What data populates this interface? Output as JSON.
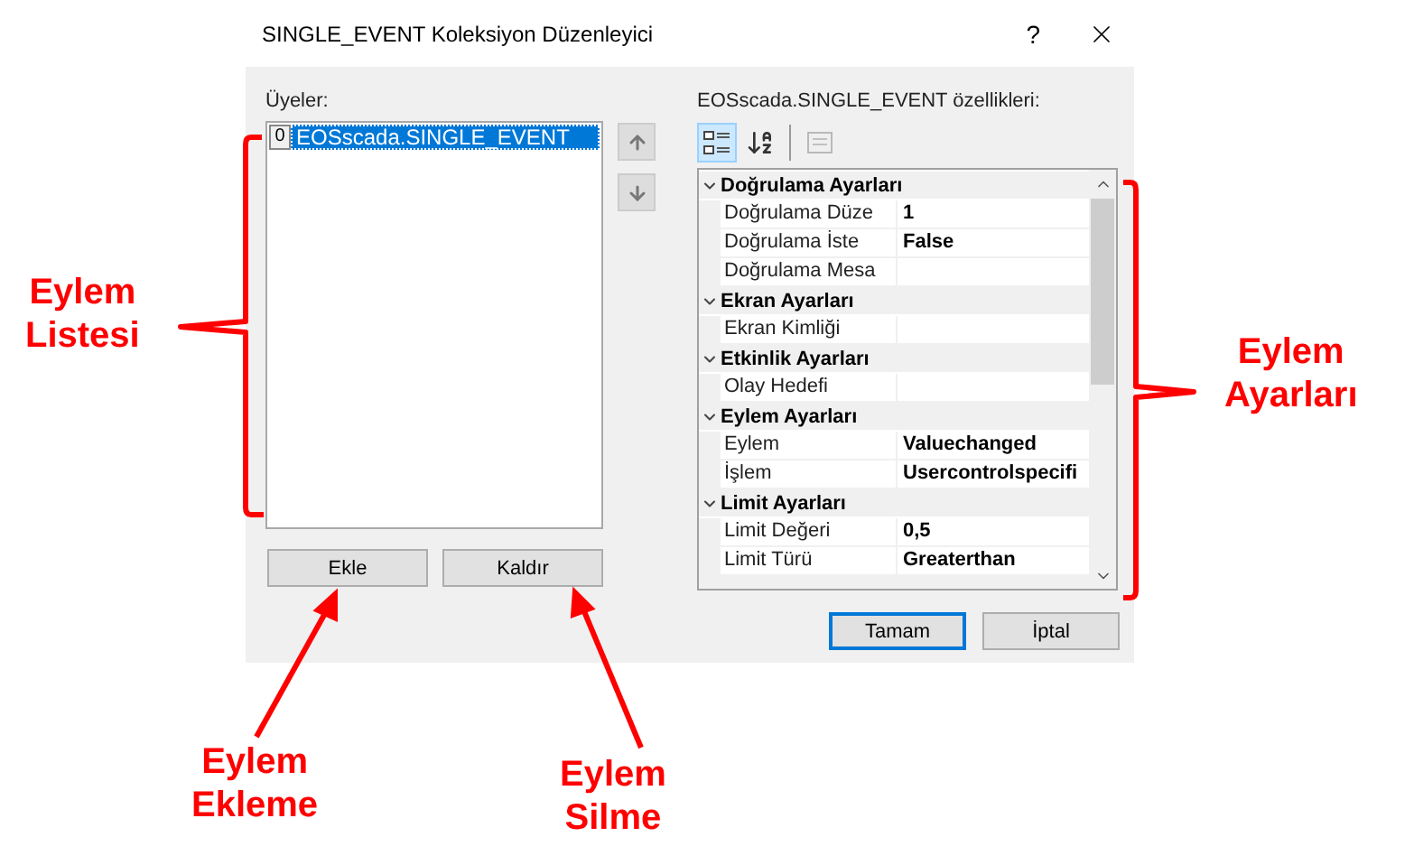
{
  "window": {
    "title": "SINGLE_EVENT Koleksiyon Düzenleyici",
    "help": "?"
  },
  "members": {
    "label": "Üyeler:",
    "items": [
      {
        "index": "0",
        "label": "EOSscada.SINGLE_EVENT",
        "selected": true
      }
    ]
  },
  "member_buttons": [
    "Ekle",
    "Kaldır"
  ],
  "properties": {
    "label": "EOSscada.SINGLE_EVENT özellikleri:",
    "toolbar": [
      {
        "kind": "categorized",
        "selected": true,
        "disabled": false
      },
      {
        "kind": "alphabetical",
        "selected": false,
        "disabled": false
      },
      {
        "kind": "property-pages",
        "selected": false,
        "disabled": true
      }
    ],
    "categories": [
      {
        "name": "Doğrulama Ayarları",
        "expanded": true,
        "items": [
          {
            "name": "Doğrulama Düze",
            "value": "1"
          },
          {
            "name": "Doğrulama İste",
            "value": "False"
          },
          {
            "name": "Doğrulama Mesa"
          }
        ]
      },
      {
        "name": "Ekran Ayarları",
        "expanded": true,
        "items": [
          {
            "name": "Ekran Kimliği"
          }
        ]
      },
      {
        "name": "Etkinlik Ayarları",
        "expanded": true,
        "items": [
          {
            "name": "Olay Hedefi"
          }
        ]
      },
      {
        "name": "Eylem Ayarları",
        "expanded": true,
        "items": [
          {
            "name": "Eylem",
            "value": "Valuechanged"
          },
          {
            "name": "İşlem",
            "value": "Usercontrolspecifi"
          }
        ]
      },
      {
        "name": "Limit Ayarları",
        "expanded": true,
        "items": [
          {
            "name": "Limit Değeri",
            "value": "0,5"
          },
          {
            "name": "Limit Türü",
            "value": "Greaterthan"
          }
        ]
      }
    ]
  },
  "dialog_buttons": [
    {
      "label": "Tamam",
      "default": true
    },
    {
      "label": "İptal",
      "default": false
    }
  ],
  "annotations": [
    {
      "kind": "bracket-left",
      "lines": [
        "Eylem",
        "Listesi"
      ]
    },
    {
      "kind": "bracket-right",
      "lines": [
        "Eylem",
        "Ayarları"
      ]
    },
    {
      "kind": "arrow-add",
      "lines": [
        "Eylem",
        "Ekleme"
      ]
    },
    {
      "kind": "arrow-remove",
      "lines": [
        "Eylem",
        "Silme"
      ]
    }
  ]
}
